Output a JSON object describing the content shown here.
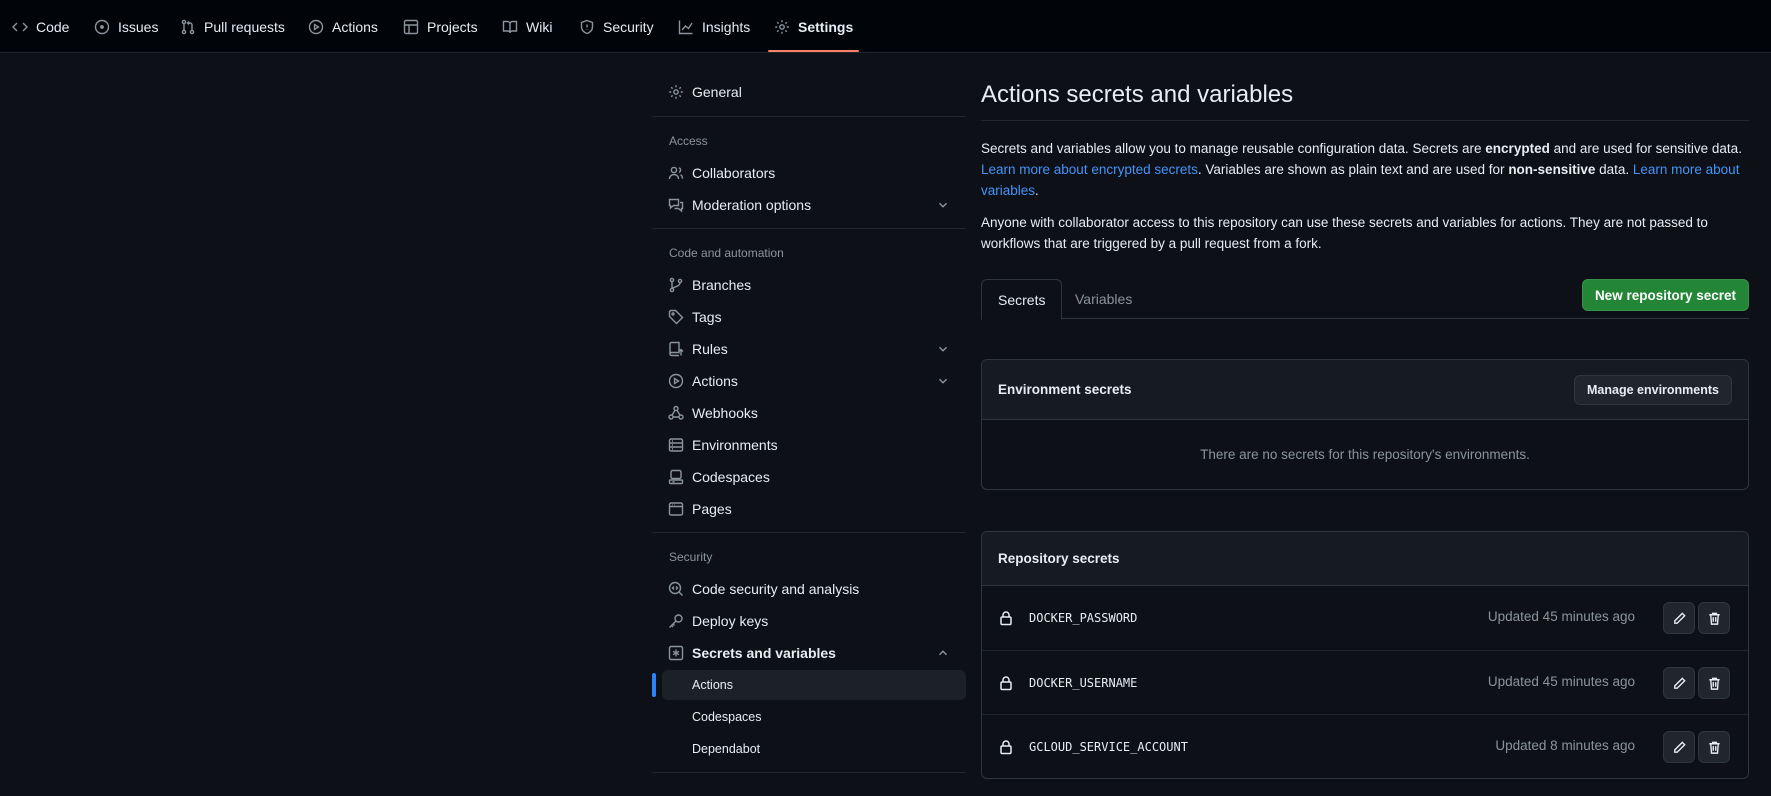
{
  "topnav": {
    "tabs": [
      {
        "label": "Code",
        "icon": "code-icon"
      },
      {
        "label": "Issues",
        "icon": "issue-opened-icon"
      },
      {
        "label": "Pull requests",
        "icon": "git-pull-request-icon"
      },
      {
        "label": "Actions",
        "icon": "play-icon"
      },
      {
        "label": "Projects",
        "icon": "table-icon"
      },
      {
        "label": "Wiki",
        "icon": "book-icon"
      },
      {
        "label": "Security",
        "icon": "shield-icon"
      },
      {
        "label": "Insights",
        "icon": "graph-icon"
      },
      {
        "label": "Settings",
        "icon": "gear-icon",
        "active": true
      }
    ]
  },
  "sidebar": {
    "general": "General",
    "access_heading": "Access",
    "collaborators": "Collaborators",
    "moderation": "Moderation options",
    "code_heading": "Code and automation",
    "branches": "Branches",
    "tags": "Tags",
    "rules": "Rules",
    "actions": "Actions",
    "webhooks": "Webhooks",
    "environments": "Environments",
    "codespaces": "Codespaces",
    "pages": "Pages",
    "security_heading": "Security",
    "code_security": "Code security and analysis",
    "deploy_keys": "Deploy keys",
    "secrets": "Secrets and variables",
    "sub_actions": "Actions",
    "sub_codespaces": "Codespaces",
    "sub_dependabot": "Dependabot",
    "accent_color": "#2f81f7"
  },
  "main": {
    "title": "Actions secrets and variables",
    "desc1": {
      "t1": "Secrets and variables allow you to manage reusable configuration data. Secrets are ",
      "b1": "encrypted",
      "t2": " and are used for sensitive data. ",
      "link1": "Learn more about encrypted secrets",
      "t3": ". Variables are shown as plain text and are used for ",
      "b2": "non-sensitive",
      "t4": " data. ",
      "link2": "Learn more about variables",
      "t5": "."
    },
    "desc2": "Anyone with collaborator access to this repository can use these secrets and variables for actions. They are not passed to workflows that are triggered by a pull request from a fork.",
    "tab_secrets": "Secrets",
    "tab_variables": "Variables",
    "new_secret_button": "New repository secret",
    "env_secrets": {
      "title": "Environment secrets",
      "manage_button": "Manage environments",
      "empty": "There are no secrets for this repository's environments."
    },
    "repo_secrets": {
      "title": "Repository secrets",
      "rows": [
        {
          "name": "DOCKER_PASSWORD",
          "updated": "Updated 45 minutes ago"
        },
        {
          "name": "DOCKER_USERNAME",
          "updated": "Updated 45 minutes ago"
        },
        {
          "name": "GCLOUD_SERVICE_ACCOUNT",
          "updated": "Updated 8 minutes ago"
        }
      ]
    },
    "primary_color": "#238636",
    "link_color": "#4493f8"
  }
}
